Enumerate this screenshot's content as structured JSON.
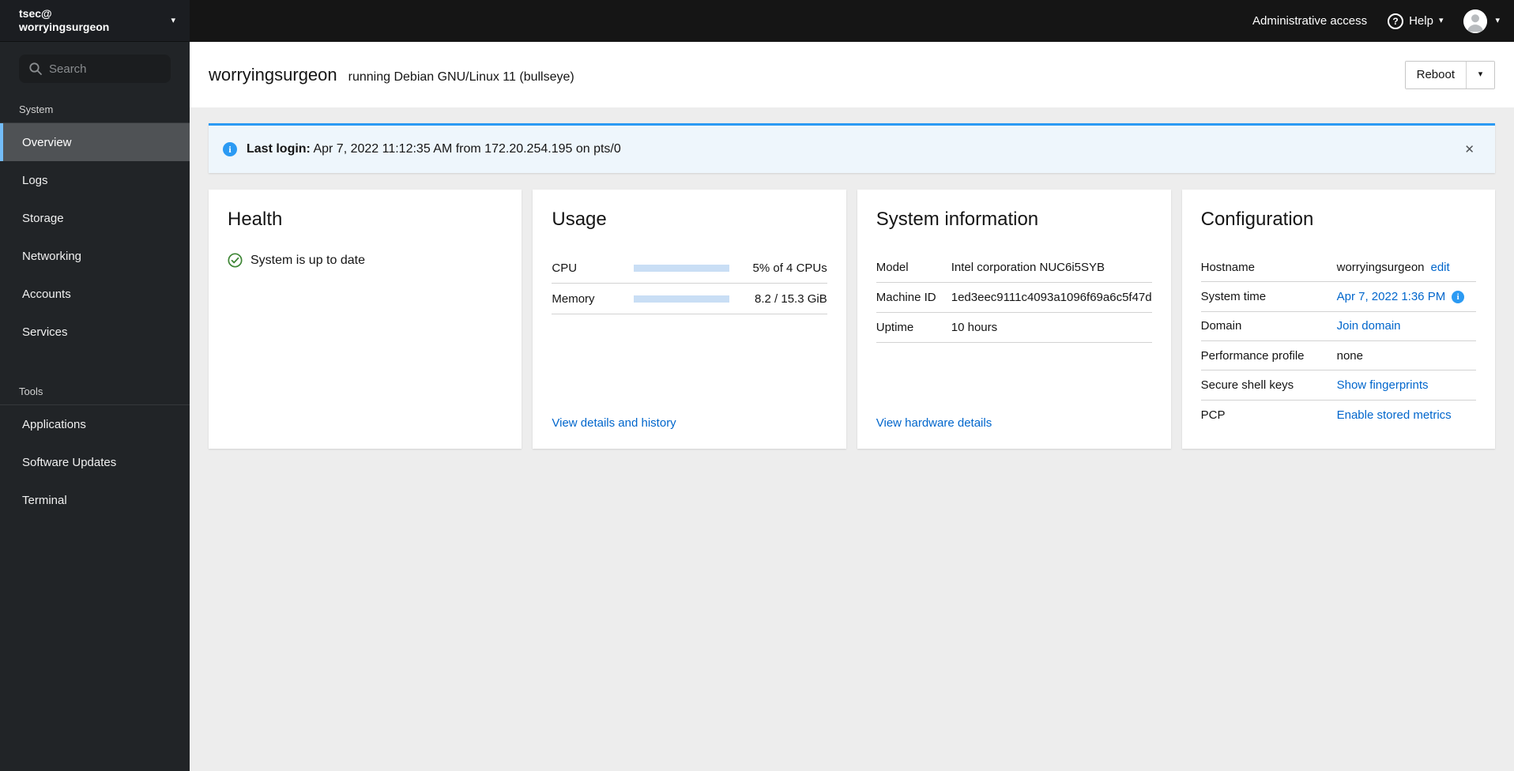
{
  "colors": {
    "accent": "#0066cc",
    "info_blue": "#2b9af3",
    "success_green": "#3e8635",
    "nav_highlight": "#73bcf7"
  },
  "masthead": {
    "user": "tsec@",
    "hostname": "worryingsurgeon",
    "admin_access_label": "Administrative access",
    "help_label": "Help"
  },
  "sidebar": {
    "search_placeholder": "Search",
    "sections": [
      {
        "label": "System",
        "items": [
          {
            "label": "Overview"
          },
          {
            "label": "Logs"
          },
          {
            "label": "Storage"
          },
          {
            "label": "Networking"
          },
          {
            "label": "Accounts"
          },
          {
            "label": "Services"
          }
        ]
      },
      {
        "label": "Tools",
        "items": [
          {
            "label": "Applications"
          },
          {
            "label": "Software Updates"
          },
          {
            "label": "Terminal"
          }
        ]
      }
    ]
  },
  "page_header": {
    "hostname": "worryingsurgeon",
    "os_text": "running Debian GNU/Linux 11 (bullseye)",
    "reboot_label": "Reboot"
  },
  "alert": {
    "title": "Last login:",
    "message": "Apr 7, 2022 11:12:35 AM from 172.20.254.195 on pts/0"
  },
  "cards": {
    "health": {
      "title": "Health",
      "status_text": "System is up to date"
    },
    "usage": {
      "title": "Usage",
      "rows": [
        {
          "label": "CPU",
          "value": "5% of 4 CPUs",
          "percent": 5
        },
        {
          "label": "Memory",
          "value": "8.2 / 15.3 GiB",
          "percent": 54
        }
      ],
      "link_label": "View details and history"
    },
    "system_information": {
      "title": "System information",
      "rows": [
        {
          "label": "Model",
          "value": "Intel corporation NUC6i5SYB"
        },
        {
          "label": "Machine ID",
          "value": "1ed3eec9111c4093a1096f69a6c5f47d"
        },
        {
          "label": "Uptime",
          "value": "10 hours"
        }
      ],
      "link_label": "View hardware details"
    },
    "configuration": {
      "title": "Configuration",
      "rows": [
        {
          "label": "Hostname",
          "value": "worryingsurgeon",
          "link": "edit"
        },
        {
          "label": "System time",
          "link": "Apr 7, 2022 1:36 PM"
        },
        {
          "label": "Domain",
          "link": "Join domain"
        },
        {
          "label": "Performance profile",
          "value": "none"
        },
        {
          "label": "Secure shell keys",
          "link": "Show fingerprints"
        },
        {
          "label": "PCP",
          "link": "Enable stored metrics"
        }
      ]
    }
  }
}
